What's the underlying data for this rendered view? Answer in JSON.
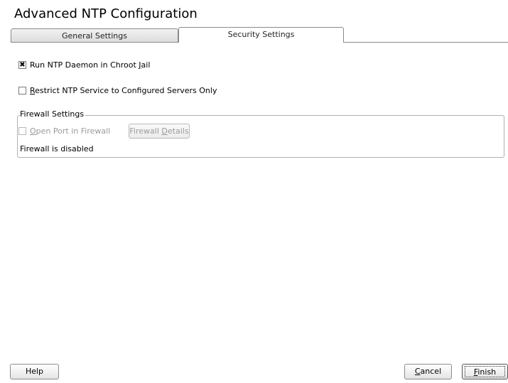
{
  "window": {
    "title": "Advanced NTP Configuration"
  },
  "tabs": [
    {
      "label": "General Settings",
      "active": false
    },
    {
      "label": "Security Settings",
      "active": true
    }
  ],
  "security": {
    "chroot": {
      "label_pre": "Run NTP Daemon in Chroot ",
      "label_mn": "J",
      "label_post": "ail",
      "checked": true
    },
    "restrict": {
      "label_mn": "R",
      "label_post": "estrict NTP Service to Configured Servers Only",
      "checked": false
    }
  },
  "firewall": {
    "legend": "Firewall Settings",
    "open_port": {
      "label_mn": "O",
      "label_post": "pen Port in Firewall",
      "checked": false,
      "enabled": false
    },
    "details_button": {
      "label_pre": "Firewall ",
      "label_mn": "D",
      "label_post": "etails"
    },
    "status": "Firewall is disabled"
  },
  "buttons": {
    "help": "Help",
    "cancel_mn": "C",
    "cancel_post": "ancel",
    "finish_mn": "F",
    "finish_post": "inish"
  }
}
